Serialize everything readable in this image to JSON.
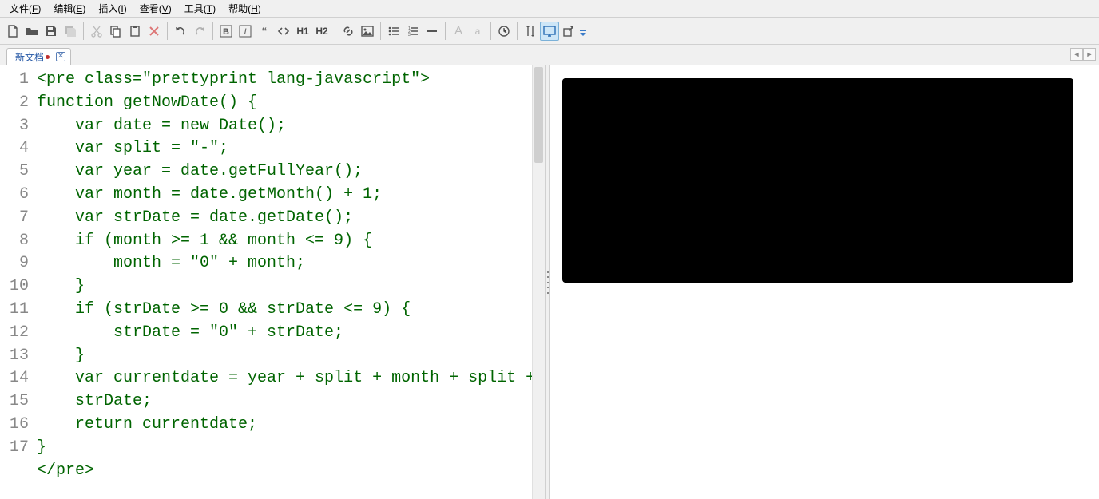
{
  "menu": {
    "items": [
      {
        "label": "文件",
        "key": "F"
      },
      {
        "label": "编辑",
        "key": "E"
      },
      {
        "label": "插入",
        "key": "I"
      },
      {
        "label": "查看",
        "key": "V"
      },
      {
        "label": "工具",
        "key": "T"
      },
      {
        "label": "帮助",
        "key": "H"
      }
    ]
  },
  "toolbar": {
    "h1": "H1",
    "h2": "H2",
    "boldA": "A",
    "smallA": "a"
  },
  "tab": {
    "title": "新文档",
    "close": "✕"
  },
  "code": {
    "lines": [
      "<pre class=\"prettyprint lang-javascript\">",
      "function getNowDate() {",
      "    var date = new Date();",
      "    var split = \"-\";",
      "    var year = date.getFullYear();",
      "    var month = date.getMonth() + 1;",
      "    var strDate = date.getDate();",
      "    if (month >= 1 && month <= 9) {",
      "        month = \"0\" + month;",
      "    }",
      "    if (strDate >= 0 && strDate <= 9) {",
      "        strDate = \"0\" + strDate;",
      "    }",
      "    var currentdate = year + split + month + split + strDate;",
      "    return currentdate;",
      "}",
      "</pre>"
    ],
    "wrap_at": 56
  }
}
